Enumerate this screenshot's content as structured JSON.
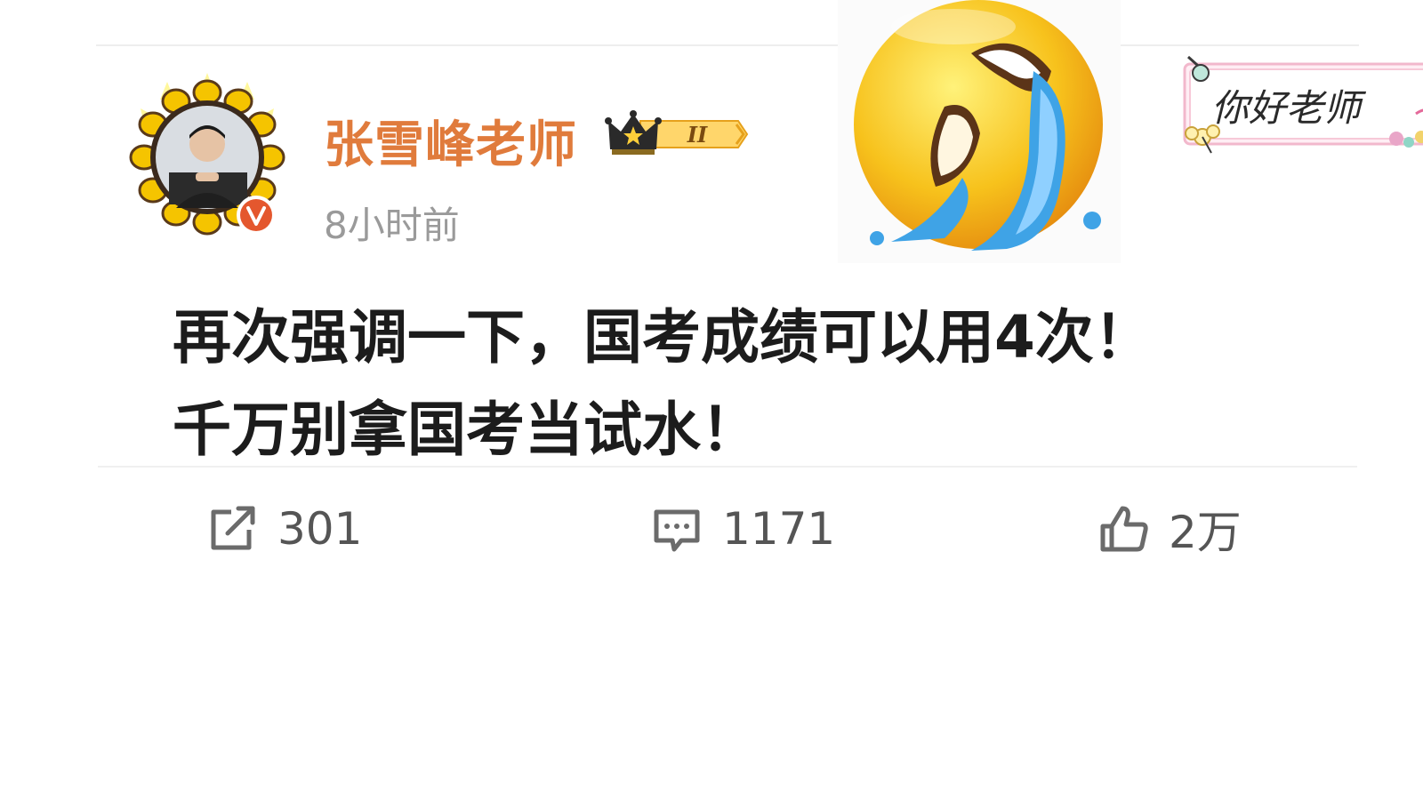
{
  "post": {
    "author": {
      "name": "张雪峰老师",
      "verified_icon": "verified-v-icon",
      "vip_level": "II"
    },
    "time": "8小时前",
    "content_lines": [
      "再次强调一下，国考成绩可以用4次！",
      "千万别拿国考当试水！"
    ],
    "stickers": {
      "crying_emoji": "crying-laughing-emoji",
      "hello_teacher_text": "你好老师"
    },
    "actions": {
      "repost_count": "301",
      "comment_count": "1171",
      "like_count": "2万"
    }
  },
  "colors": {
    "author_name": "#e07b3c",
    "timestamp": "#9a9a9a",
    "body_text": "#1c1c1c",
    "action_text": "#555555",
    "verified_badge": "#e4572e",
    "sunflower": "#f5c400"
  }
}
